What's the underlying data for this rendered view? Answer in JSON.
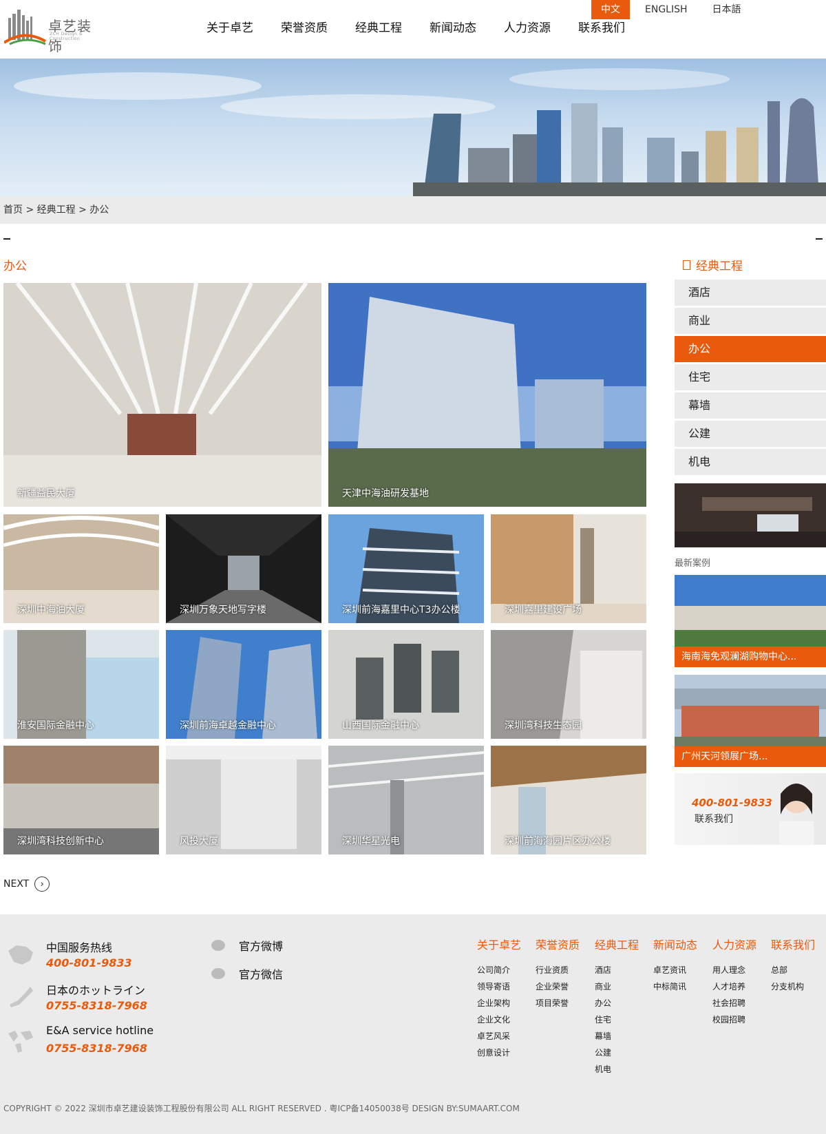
{
  "brand": {
    "name_cn": "卓艺装饰",
    "name_en": "ZCH Design & Construction"
  },
  "lang": [
    "中文",
    "ENGLISH",
    "日本語"
  ],
  "nav": [
    "关于卓艺",
    "荣誉资质",
    "经典工程",
    "新闻动态",
    "人力资源",
    "联系我们"
  ],
  "breadcrumb": "首页 > 经典工程 > 办公",
  "section_title": "办公",
  "projects": [
    {
      "caption": "新疆益民大厦"
    },
    {
      "caption": "天津中海油研发基地"
    },
    {
      "caption": "深圳中海油大厦"
    },
    {
      "caption": "深圳万象天地写字楼"
    },
    {
      "caption": "深圳前海嘉里中心T3办公楼"
    },
    {
      "caption": "深圳嘉里建设广场"
    },
    {
      "caption": "淮安国际金融中心"
    },
    {
      "caption": "深圳前海卓越金融中心"
    },
    {
      "caption": "山西国际金融中心"
    },
    {
      "caption": "深圳湾科技生态园"
    },
    {
      "caption": "深圳湾科技创新中心"
    },
    {
      "caption": "风投大厦"
    },
    {
      "caption": "深圳华星光电"
    },
    {
      "caption": "深圳前海海园片区办公楼"
    }
  ],
  "next_label": "NEXT",
  "sidebar": {
    "title": "经典工程",
    "items": [
      "酒店",
      "商业",
      "办公",
      "住宅",
      "幕墙",
      "公建",
      "机电"
    ],
    "active_index": 2,
    "latest_title": "最新案例",
    "latest": [
      "海南海免观澜湖购物中心...",
      "广州天河领展广场..."
    ],
    "contact": {
      "tel": "400-801-9833",
      "label": "联系我们"
    }
  },
  "footer": {
    "hotlines": [
      {
        "title": "中国服务热线",
        "number": "400-801-9833"
      },
      {
        "title": "日本のホットライン",
        "number": "0755-8318-7968"
      },
      {
        "title": "E&A service hotline",
        "number": "0755-8318-7968"
      }
    ],
    "social": [
      "官方微博",
      "官方微信"
    ],
    "columns": [
      {
        "title": "关于卓艺",
        "links": [
          "公司简介",
          "领导寄语",
          "企业架构",
          "企业文化",
          "卓艺风采",
          "创意设计"
        ]
      },
      {
        "title": "荣誉资质",
        "links": [
          "行业资质",
          "企业荣誉",
          "项目荣誉"
        ]
      },
      {
        "title": "经典工程",
        "links": [
          "酒店",
          "商业",
          "办公",
          "住宅",
          "幕墙",
          "公建",
          "机电"
        ]
      },
      {
        "title": "新闻动态",
        "links": [
          "卓艺资讯",
          "中标简讯"
        ]
      },
      {
        "title": "人力资源",
        "links": [
          "用人理念",
          "人才培养",
          "社会招聘",
          "校园招聘"
        ]
      },
      {
        "title": "联系我们",
        "links": [
          "总部",
          "分支机构"
        ]
      }
    ],
    "copyright": "COPYRIGHT © 2022 深圳市卓艺建设装饰工程股份有限公司 ALL RIGHT RESERVED . 粤ICP备14050038号      DESIGN BY:SUMAART.COM"
  },
  "colors": {
    "accent": "#e95a0c",
    "light_bg": "#ebebeb"
  }
}
